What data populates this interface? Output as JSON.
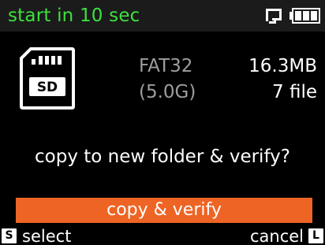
{
  "header": {
    "title": "start in 10 sec",
    "title_color": "#3fe040",
    "link_icon": "usb-link-icon",
    "battery_icon": "battery-full-icon"
  },
  "card": {
    "icon": "sd-card-icon",
    "icon_label": "SD",
    "filesystem": "FAT32",
    "capacity": "(5.0G)",
    "data_size": "16.3MB",
    "file_count": "7 file"
  },
  "dialog": {
    "question": "copy to new folder & verify?",
    "action_label": "copy & verify",
    "action_color": "#ee6424"
  },
  "footer": {
    "select_key": "S",
    "select_label": "select",
    "cancel_key": "L",
    "cancel_label": "cancel"
  }
}
